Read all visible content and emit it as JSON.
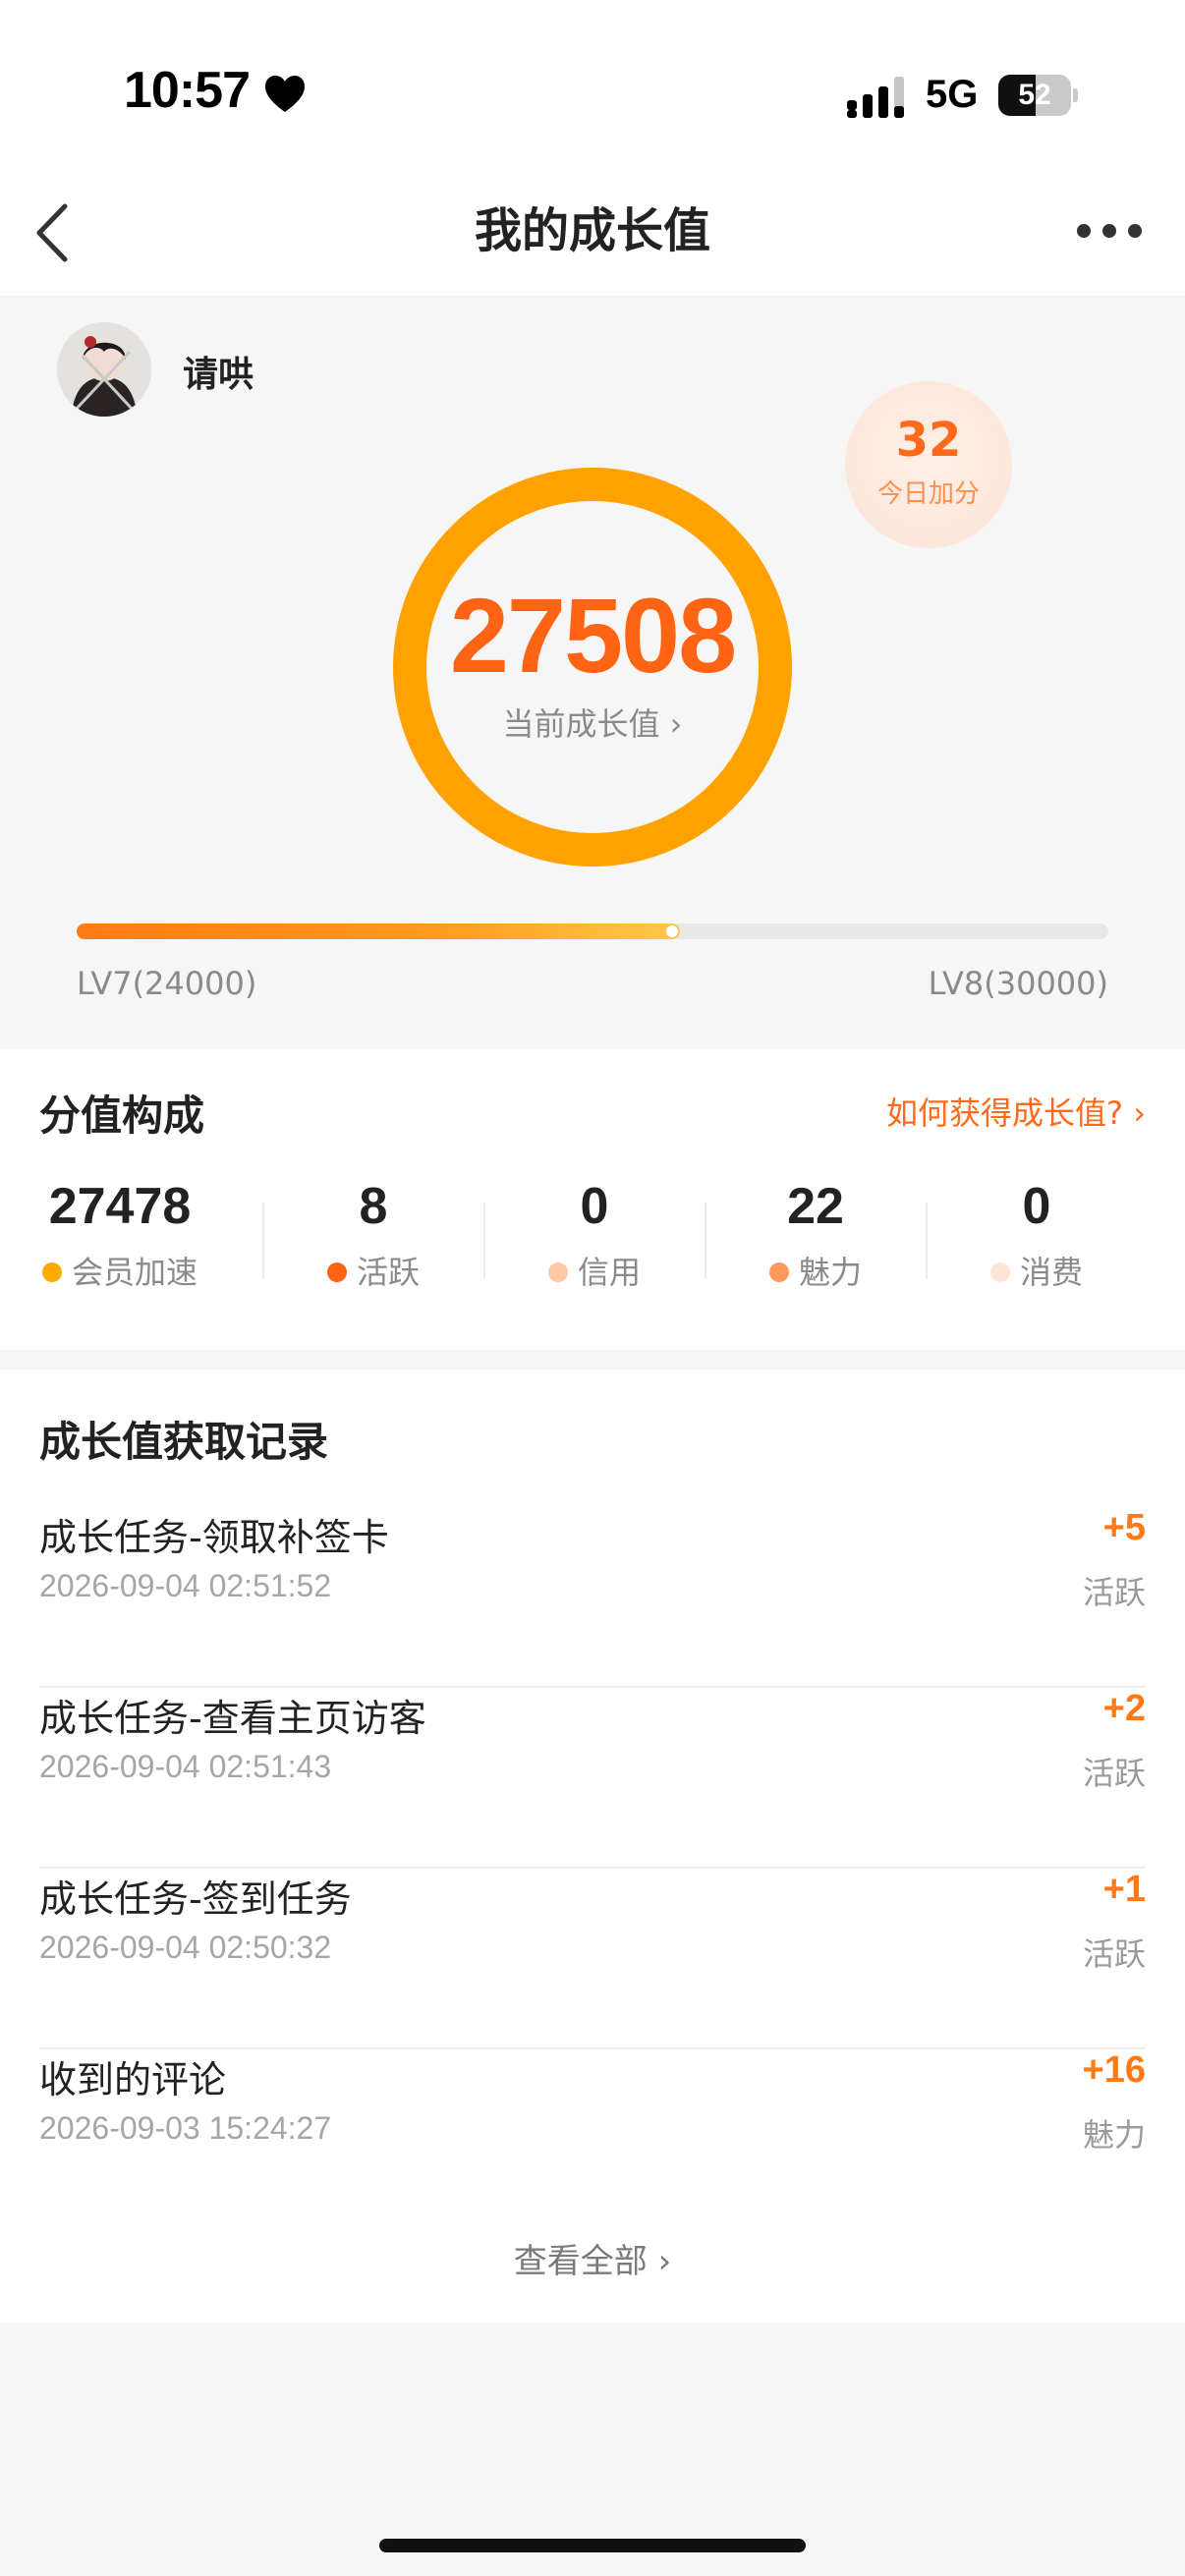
{
  "status_bar": {
    "time": "10:57",
    "network": "5G",
    "battery": "52",
    "battery_level": 0.52,
    "icons": [
      "heart-icon",
      "signal-icon",
      "battery-icon"
    ]
  },
  "nav": {
    "title": "我的成长值",
    "icons": [
      "back-chevron-icon",
      "more-dots-icon"
    ]
  },
  "profile": {
    "username": "请哄",
    "today_value": "32",
    "today_label": "今日加分"
  },
  "growth": {
    "current_value": "27508",
    "current_label": "当前成长值 ›",
    "progress_fraction": 0.5847,
    "level_current": "LV7(24000)",
    "level_next": "LV8(30000)"
  },
  "composition": {
    "title": "分值构成",
    "how_link": "如何获得成长值? ›",
    "stats": [
      {
        "value": "27478",
        "label": "会员加速",
        "color": "#ffaa00"
      },
      {
        "value": "8",
        "label": "活跃",
        "color": "#ff6314"
      },
      {
        "value": "0",
        "label": "信用",
        "color": "#ffc9a8"
      },
      {
        "value": "22",
        "label": "魅力",
        "color": "#ff9a5c"
      },
      {
        "value": "0",
        "label": "消费",
        "color": "#fde5d8"
      }
    ]
  },
  "records": {
    "title": "成长值获取记录",
    "items": [
      {
        "title": "成长任务-领取补签卡",
        "time": "2026-09-04 02:51:52",
        "points": "+5",
        "type": "活跃"
      },
      {
        "title": "成长任务-查看主页访客",
        "time": "2026-09-04 02:51:43",
        "points": "+2",
        "type": "活跃"
      },
      {
        "title": "成长任务-签到任务",
        "time": "2026-09-04 02:50:32",
        "points": "+1",
        "type": "活跃"
      },
      {
        "title": "收到的评论",
        "time": "2026-09-03 15:24:27",
        "points": "+16",
        "type": "魅力"
      }
    ],
    "view_all": "查看全部 ›"
  },
  "colors": {
    "accent": "#ff6314",
    "ring": "#ffa200",
    "background": "#f6f6f6"
  }
}
